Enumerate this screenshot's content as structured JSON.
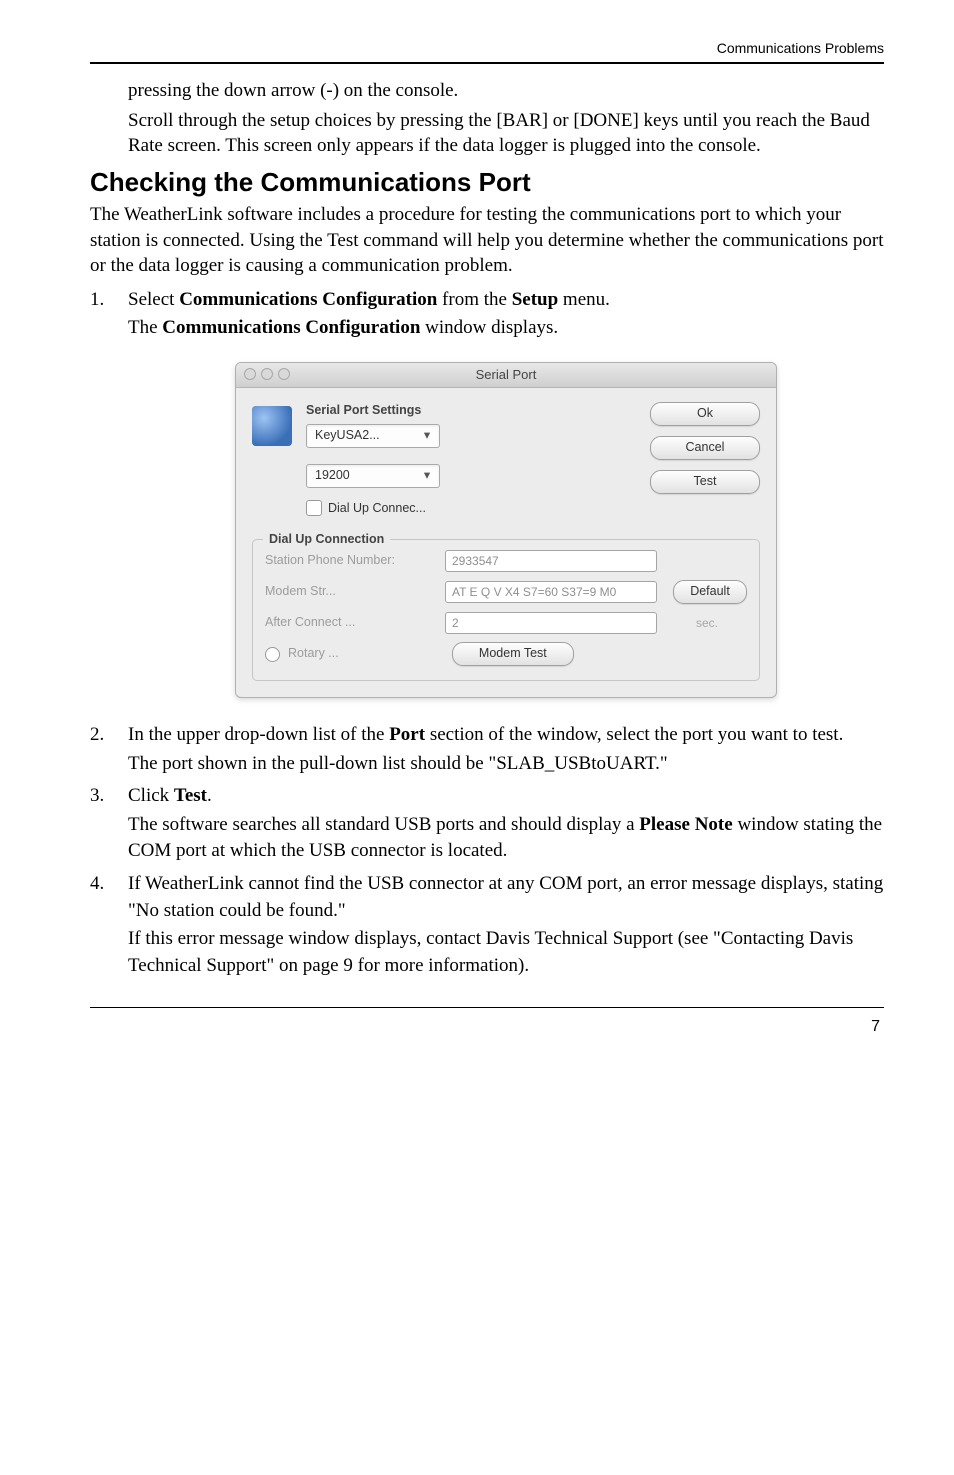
{
  "header": {
    "right": "Communications Problems"
  },
  "intro": {
    "line1": "pressing the down arrow (-) on the console.",
    "line2": "Scroll through the setup choices by pressing the [BAR] or [DONE] keys until you reach the Baud Rate screen. This screen only appears if the data logger is plugged into the console."
  },
  "section_title": "Checking the Communications Port",
  "after_h2": "The WeatherLink software includes a procedure for testing the communications port to which your station is connected. Using the Test command will help you determine whether the communications port or the data logger is causing a communication problem.",
  "steps": {
    "s1a_pre": "Select ",
    "s1a_bold": "Communications Configuration",
    "s1a_mid": " from the ",
    "s1a_bold2": "Setup",
    "s1a_post": " menu.",
    "s1b_pre": "The ",
    "s1b_bold": "Communications Configuration",
    "s1b_post": " window displays.",
    "s2a_pre": "In the upper drop-down list of the ",
    "s2a_bold": "Port",
    "s2a_post": " section of the window, select the port you want to test.",
    "s2b": "The port shown in the pull-down list should be \"SLAB_USBtoUART.\"",
    "s3a_pre": "Click ",
    "s3a_bold": "Test",
    "s3a_post": ".",
    "s3b_pre": "The software searches all standard USB ports and should display a ",
    "s3b_bold": "Please Note",
    "s3b_post": " window stating the COM port at which the USB connector is located.",
    "s4a": "If WeatherLink cannot find the USB connector at any COM port, an error message displays, stating \"No station could be found.\"",
    "s4b": "If this error message window displays, contact Davis Technical Support (see \"Contacting Davis Technical Support\" on page 9 for more information)."
  },
  "dialog": {
    "title": "Serial Port",
    "group_label": "Serial Port Settings",
    "port_value": "KeyUSA2...",
    "baud_value": "19200",
    "check_label": "Dial Up Connec...",
    "ok": "Ok",
    "cancel": "Cancel",
    "test": "Test",
    "fs_title": "Dial Up Connection",
    "phone_label": "Station Phone Number:",
    "phone_value": "2933547",
    "modem_label": "Modem Str...",
    "modem_value": "AT E Q V X4 S7=60 S37=9 M0",
    "default_btn": "Default",
    "after_label": "After Connect ...",
    "after_value": "2",
    "sec": "sec.",
    "rotary": "Rotary ...",
    "modem_test": "Modem Test"
  },
  "page_number": "7"
}
